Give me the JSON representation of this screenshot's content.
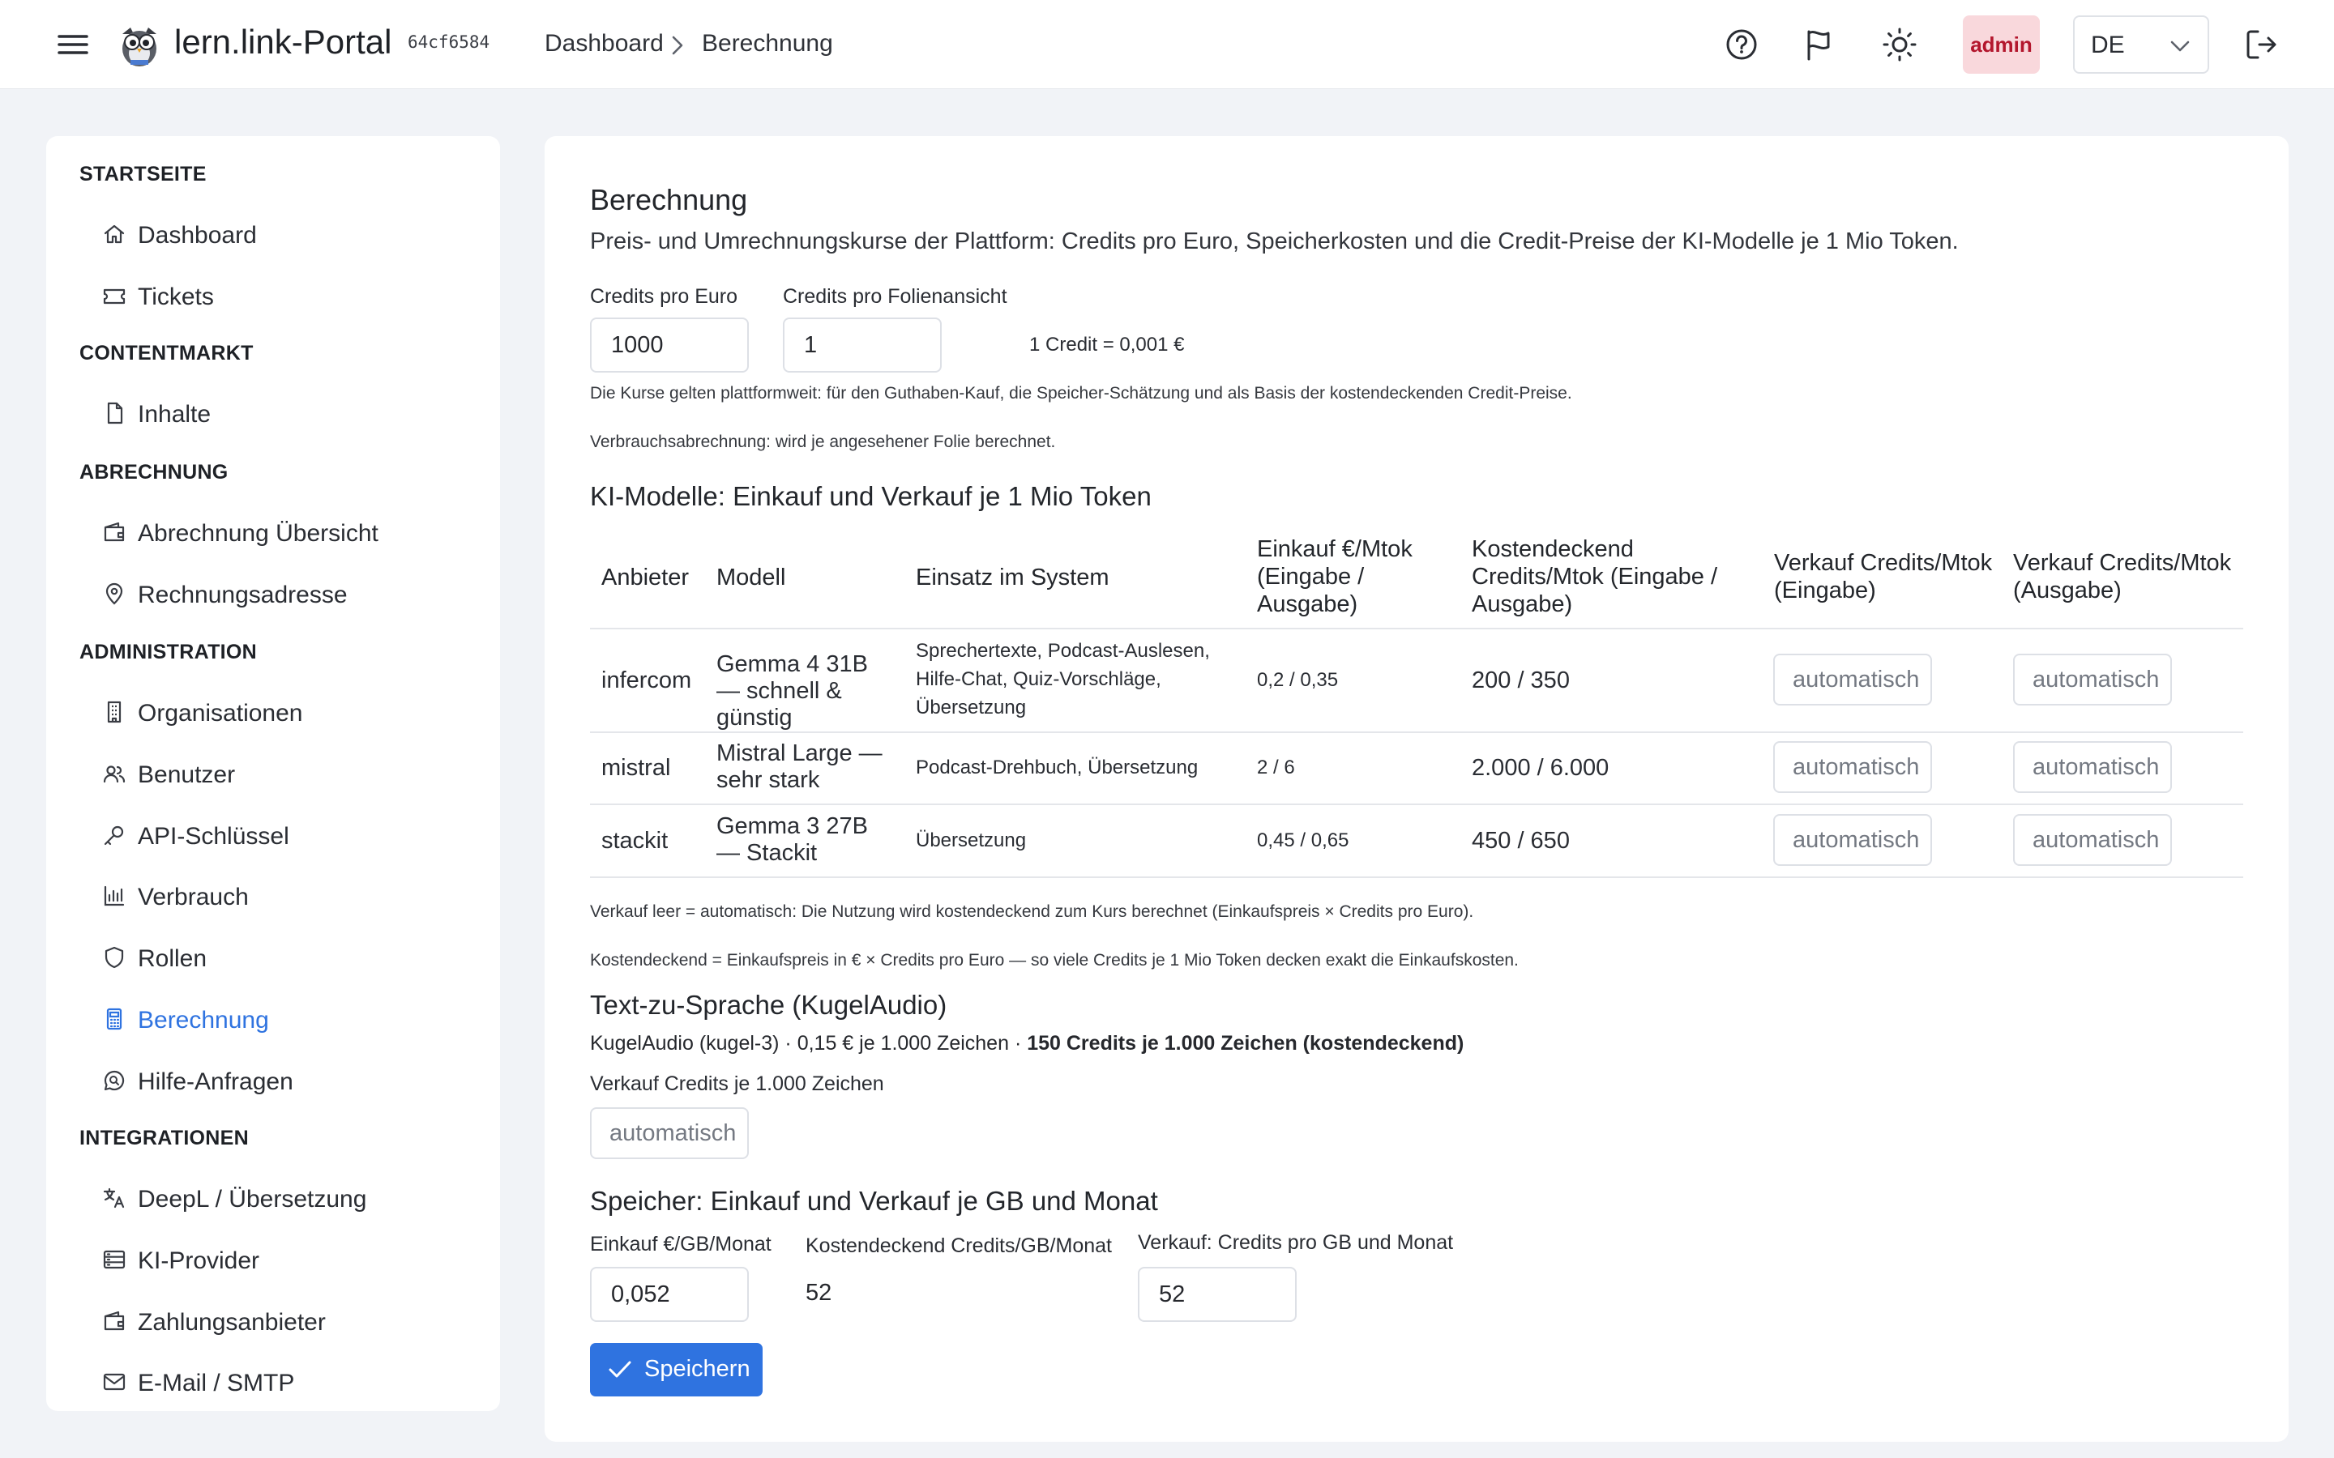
{
  "header": {
    "brand": "lern.link-Portal",
    "version_hash": "64cf6584",
    "breadcrumb": [
      "Dashboard",
      "Berechnung"
    ],
    "user_badge": "admin",
    "language": "DE",
    "icons": [
      "menu-icon",
      "logo-icon",
      "chevron-right-icon",
      "help-circle-icon",
      "flag-icon",
      "sun-icon",
      "chevron-down-icon",
      "logout-icon"
    ]
  },
  "sidebar": {
    "sections": [
      {
        "title": "STARTSEITE",
        "items": [
          {
            "label": "Dashboard",
            "icon": "home-icon"
          },
          {
            "label": "Tickets",
            "icon": "ticket-icon"
          }
        ]
      },
      {
        "title": "CONTENTMARKT",
        "items": [
          {
            "label": "Inhalte",
            "icon": "file-icon"
          }
        ]
      },
      {
        "title": "ABRECHNUNG",
        "items": [
          {
            "label": "Abrechnung Übersicht",
            "icon": "wallet-icon"
          },
          {
            "label": "Rechnungsadresse",
            "icon": "map-pin-icon"
          }
        ]
      },
      {
        "title": "ADMINISTRATION",
        "items": [
          {
            "label": "Organisationen",
            "icon": "building-icon"
          },
          {
            "label": "Benutzer",
            "icon": "users-icon"
          },
          {
            "label": "API-Schlüssel",
            "icon": "key-icon"
          },
          {
            "label": "Verbrauch",
            "icon": "bar-chart-icon"
          },
          {
            "label": "Rollen",
            "icon": "shield-icon"
          },
          {
            "label": "Berechnung",
            "icon": "calculator-icon",
            "active": true
          },
          {
            "label": "Hilfe-Anfragen",
            "icon": "message-search-icon"
          }
        ]
      },
      {
        "title": "INTEGRATIONEN",
        "items": [
          {
            "label": "DeepL / Übersetzung",
            "icon": "translate-icon"
          },
          {
            "label": "KI-Provider",
            "icon": "server-icon"
          },
          {
            "label": "Zahlungsanbieter",
            "icon": "wallet-icon"
          },
          {
            "label": "E-Mail / SMTP",
            "icon": "mail-icon"
          }
        ]
      }
    ],
    "active_color": "#2f73e0"
  },
  "main": {
    "title": "Berechnung",
    "description": "Preis- und Umrechnungskurse der Plattform: Credits pro Euro, Speicherkosten und die Credit-Preise der KI-Modelle je 1 Mio Token.",
    "credits_per_euro": {
      "label": "Credits pro Euro",
      "value": "1000"
    },
    "credits_per_slide": {
      "label": "Credits pro Folienansicht",
      "value": "1"
    },
    "conversion_text": "1 Credit = 0,001 €",
    "note_rates": "Die Kurse gelten plattformweit: für den Guthaben-Kauf, die Speicher-Schätzung und als Basis der kostendeckenden Credit-Preise.",
    "note_usage": "Verbrauchsabrechnung: wird je angesehener Folie berechnet.",
    "models_heading": "KI-Modelle: Einkauf und Verkauf je 1 Mio Token",
    "table": {
      "headers": [
        "Anbieter",
        "Modell",
        "Einsatz im System",
        "Einkauf €/Mtok (Eingabe / Ausgabe)",
        "Kostendeckend Credits/Mtok (Eingabe / Ausgabe)",
        "Verkauf Credits/Mtok (Eingabe)",
        "Verkauf Credits/Mtok (Ausgabe)"
      ],
      "rows": [
        {
          "provider": "infercom",
          "model": "Gemma 4 31B — schnell & günstig",
          "usage": "Sprechertexte, Podcast-Auslesen, Hilfe-Chat, Quiz-Vorschläge, Übersetzung",
          "purchase": "0,2 / 0,35",
          "cost_covering": "200 / 350",
          "sell_in_placeholder": "automatisch",
          "sell_out_placeholder": "automatisch"
        },
        {
          "provider": "mistral",
          "model": "Mistral Large — sehr stark",
          "usage": "Podcast-Drehbuch, Übersetzung",
          "purchase": "2 / 6",
          "cost_covering": "2.000 / 6.000",
          "sell_in_placeholder": "automatisch",
          "sell_out_placeholder": "automatisch"
        },
        {
          "provider": "stackit",
          "model": "Gemma 3 27B — Stackit",
          "usage": "Übersetzung",
          "purchase": "0,45 / 0,65",
          "cost_covering": "450 / 650",
          "sell_in_placeholder": "automatisch",
          "sell_out_placeholder": "automatisch"
        }
      ]
    },
    "note_sell_empty": "Verkauf leer = automatisch: Die Nutzung wird kostendeckend zum Kurs berechnet (Einkaufspreis × Credits pro Euro).",
    "note_cost_covering": "Kostendeckend = Einkaufspreis in € × Credits pro Euro — so viele Credits je 1 Mio Token decken exakt die Einkaufskosten.",
    "tts_heading": "Text-zu-Sprache (KugelAudio)",
    "tts_info_plain": "KugelAudio (kugel-3) · 0,15 € je 1.000 Zeichen · ",
    "tts_info_bold": "150 Credits je 1.000 Zeichen (kostendeckend)",
    "tts_sell_label": "Verkauf Credits je 1.000 Zeichen",
    "tts_sell_placeholder": "automatisch",
    "storage_heading": "Speicher: Einkauf und Verkauf je GB und Monat",
    "storage_purchase_label": "Einkauf €/GB/Monat",
    "storage_purchase_value": "0,052",
    "storage_cost_label": "Kostendeckend Credits/GB/Monat",
    "storage_cost_value": "52",
    "storage_sell_label": "Verkauf: Credits pro GB und Monat",
    "storage_sell_value": "52",
    "save_label": "Speichern",
    "accent_color": "#2f73e0"
  }
}
